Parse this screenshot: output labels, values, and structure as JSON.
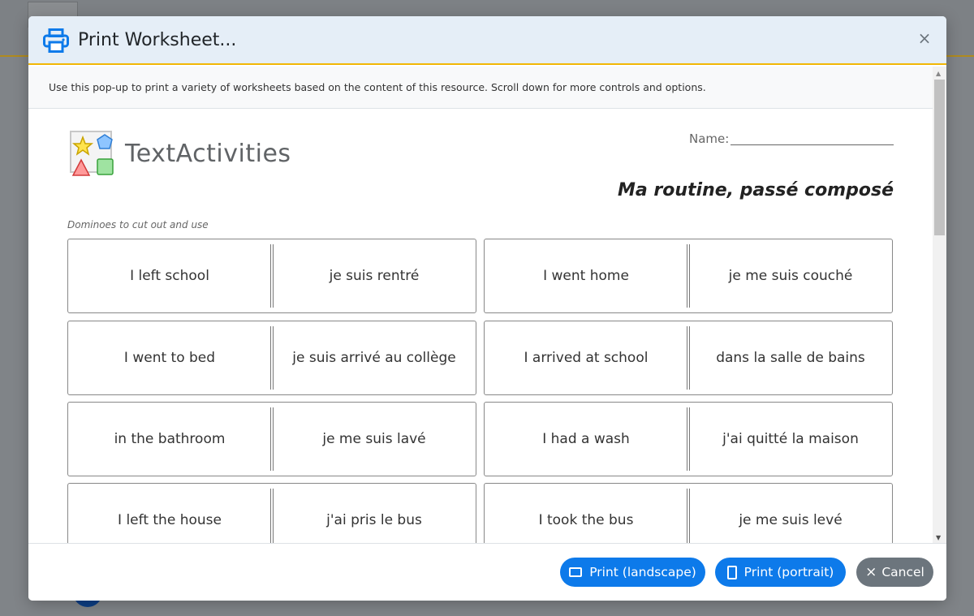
{
  "modal": {
    "title": "Print Worksheet...",
    "close_label": "×",
    "info": "Use this pop-up to print a variety of worksheets based on the content of this resource. Scroll down for more controls and options."
  },
  "worksheet": {
    "brand": "TextActivities",
    "name_label": "Name:",
    "title": "Ma routine, passé composé",
    "section_label": "Dominoes to cut out and use",
    "dominoes": [
      {
        "left": "I left school",
        "right": "je suis rentré"
      },
      {
        "left": "I went home",
        "right": "je me suis couché"
      },
      {
        "left": "I went to bed",
        "right": "je suis arrivé au collège"
      },
      {
        "left": "I arrived at school",
        "right": "dans la salle de bains"
      },
      {
        "left": "in the bathroom",
        "right": "je me suis lavé"
      },
      {
        "left": "I had a wash",
        "right": "j'ai quitté la maison"
      },
      {
        "left": "I left the house",
        "right": "j'ai pris le bus"
      },
      {
        "left": "I took the bus",
        "right": "je me suis levé"
      }
    ]
  },
  "footer": {
    "print_landscape": "Print (landscape)",
    "print_portrait": "Print (portrait)",
    "cancel": "Cancel",
    "cancel_icon": "×"
  },
  "colors": {
    "primary": "#0d7aea",
    "secondary": "#6c757d",
    "header_bg": "#e5eef7",
    "header_accent": "#f2b705"
  }
}
